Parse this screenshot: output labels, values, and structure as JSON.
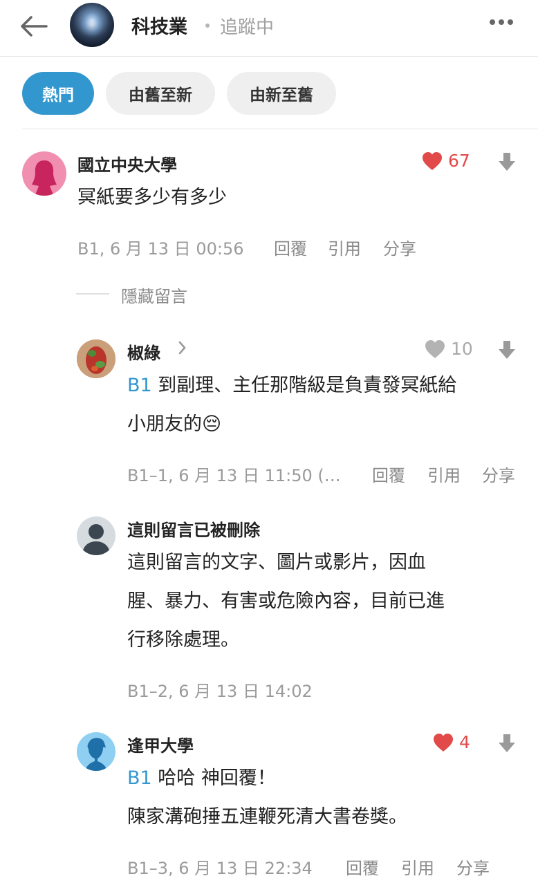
{
  "header": {
    "title": "科技業",
    "follow_status": "追蹤中"
  },
  "tabs": [
    {
      "label": "熱門",
      "active": true
    },
    {
      "label": "由舊至新",
      "active": false
    },
    {
      "label": "由新至舊",
      "active": false
    }
  ],
  "colors": {
    "accent": "#3397cf",
    "like_red": "#e24a4a",
    "meta_grey": "#9a9a9a"
  },
  "comments": [
    {
      "author": "國立中央大學",
      "likes": "67",
      "liked": true,
      "text": "冥紙要多少有多少",
      "meta": "B1, 6 月 13 日 00:56",
      "actions": {
        "reply": "回覆",
        "quote": "引用",
        "share": "分享"
      }
    }
  ],
  "hidden_replies_label": "隱藏留言",
  "replies": [
    {
      "author": "椒綠",
      "likes": "10",
      "liked": false,
      "ref": "B1",
      "line1": " 到副理、主任那階級是負責發冥紙給",
      "line2": "小朋友的",
      "emoji": "😔",
      "meta": "B1–1, 6 月 13 日 11:50 (…",
      "actions": {
        "reply": "回覆",
        "quote": "引用",
        "share": "分享"
      }
    },
    {
      "author": "這則留言已被刪除",
      "line1": "這則留言的文字、圖片或影片，因血",
      "line2": "腥、暴力、有害或危險內容，目前已進",
      "line3": "行移除處理。",
      "meta": "B1–2, 6 月 13 日 14:02"
    },
    {
      "author": "逢甲大學",
      "likes": "4",
      "liked": true,
      "ref": "B1",
      "line1": " 哈哈 神回覆！",
      "line2": "陳家溝砲捶五連鞭死清大書卷獎。",
      "meta": "B1–3, 6 月 13 日 22:34",
      "actions": {
        "reply": "回覆",
        "quote": "引用",
        "share": "分享"
      }
    }
  ],
  "icons": {
    "back": "arrow-left-icon",
    "more": "more-horizontal-icon",
    "heart": "heart-icon",
    "downvote": "downvote-arrow-icon",
    "chevron": "chevron-right-icon"
  }
}
